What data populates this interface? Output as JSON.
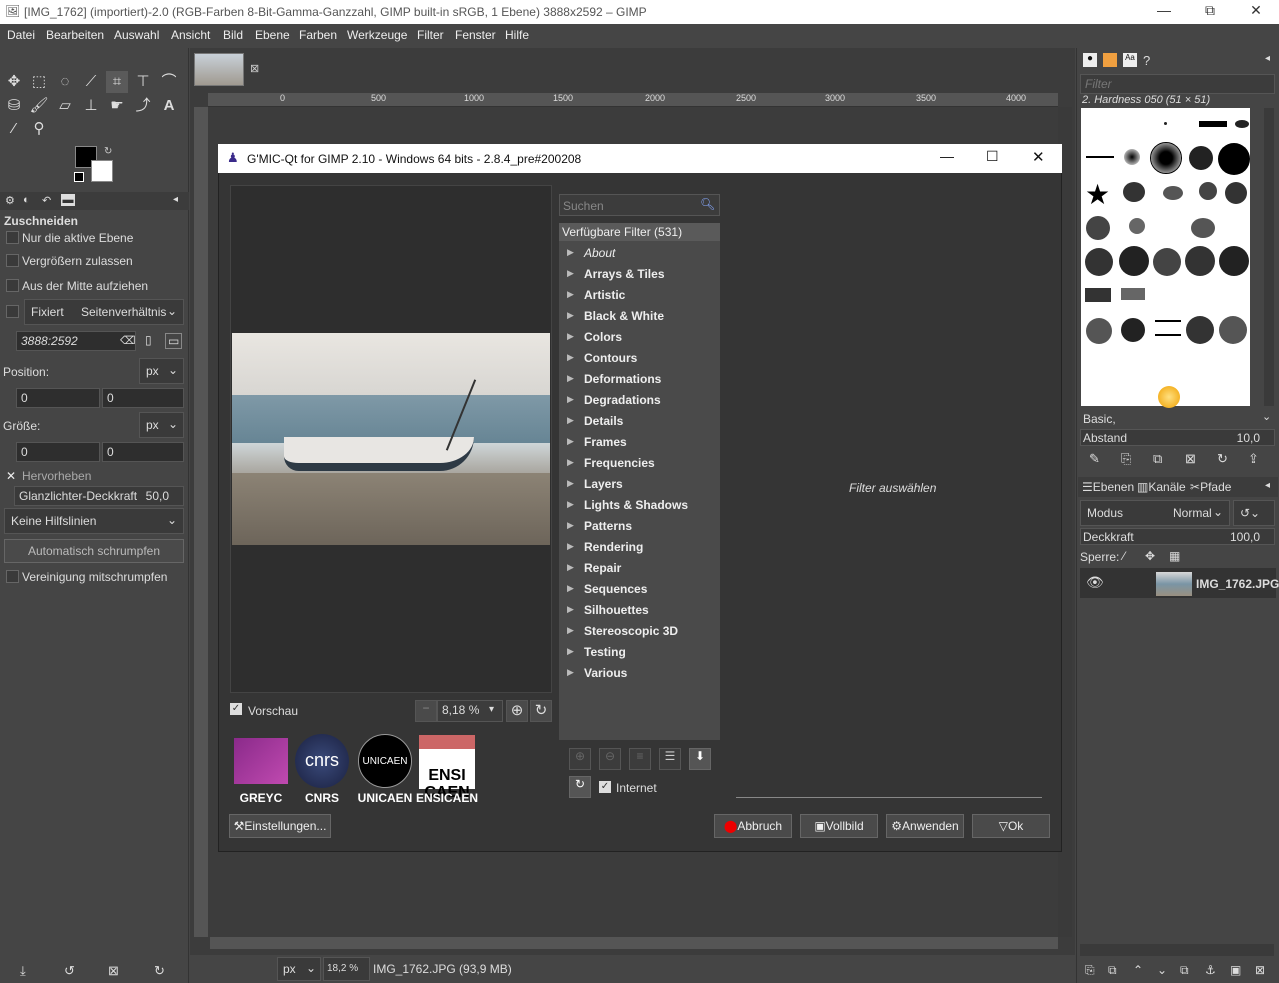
{
  "window": {
    "title": "[IMG_1762] (importiert)-2.0 (RGB-Farben 8-Bit-Gamma-Ganzzahl, GIMP built-in sRGB, 1 Ebene) 3888x2592 – GIMP"
  },
  "menu": [
    "Datei",
    "Bearbeiten",
    "Auswahl",
    "Ansicht",
    "Bild",
    "Ebene",
    "Farben",
    "Werkzeuge",
    "Filter",
    "Fenster",
    "Hilfe"
  ],
  "tool_options": {
    "title": "Zuschneiden",
    "only_active_layer": "Nur die aktive Ebene",
    "allow_growing": "Vergrößern zulassen",
    "expand_from_center": "Aus der Mitte aufziehen",
    "fixed": "Fixiert",
    "fixed_mode": "Seitenverhältnis",
    "ratio": "3888:2592",
    "position_label": "Position:",
    "unit": "px",
    "pos_x": "0",
    "pos_y": "0",
    "size_label": "Größe:",
    "size_x": "0",
    "size_y": "0",
    "highlight": "Hervorheben",
    "highlight_opacity_label": "Glanzlichter-Deckkraft",
    "highlight_opacity": "50,0",
    "guides": "Keine Hilfslinien",
    "auto_shrink": "Automatisch schrumpfen",
    "shrink_merged": "Vereinigung mitschrumpfen"
  },
  "rulers": [
    "0",
    "500",
    "1000",
    "1500",
    "2000",
    "2500",
    "3000",
    "3500",
    "4000"
  ],
  "gmic": {
    "title": "G'MIC-Qt for GIMP 2.10 - Windows 64 bits - 2.8.4_pre#200208",
    "search_placeholder": "Suchen",
    "filters_header": "Verfügbare Filter (531)",
    "categories": [
      "About",
      "Arrays & Tiles",
      "Artistic",
      "Black & White",
      "Colors",
      "Contours",
      "Deformations",
      "Degradations",
      "Details",
      "Frames",
      "Frequencies",
      "Layers",
      "Lights & Shadows",
      "Patterns",
      "Rendering",
      "Repair",
      "Sequences",
      "Silhouettes",
      "Stereoscopic 3D",
      "Testing",
      "Various"
    ],
    "select_filter": "Filter auswählen",
    "preview_label": "Vorschau",
    "zoom": "8,18 %",
    "internet": "Internet",
    "logos": [
      "GREYC",
      "CNRS",
      "UNICAEN",
      "ENSICAEN"
    ],
    "settings_button": "Einstellungen...",
    "cancel_button": "Abbruch",
    "fullscreen_button": "Vollbild",
    "apply_button": "Anwenden",
    "ok_button": "Ok"
  },
  "right_dock": {
    "filter_placeholder": "Filter",
    "brush_name": "2. Hardness 050 (51 × 51)",
    "brush_tag": "Basic,",
    "spacing_label": "Abstand",
    "spacing_value": "10,0",
    "tabs": [
      "Ebenen",
      "Kanäle",
      "Pfade"
    ],
    "mode_label": "Modus",
    "mode_value": "Normal",
    "opacity_label": "Deckkraft",
    "opacity_value": "100,0",
    "lock_label": "Sperre:",
    "layer_name": "IMG_1762.JPG"
  },
  "statusbar": {
    "unit": "px",
    "zoom": "18,2 %",
    "file_info": "IMG_1762.JPG (93,9 MB)"
  }
}
